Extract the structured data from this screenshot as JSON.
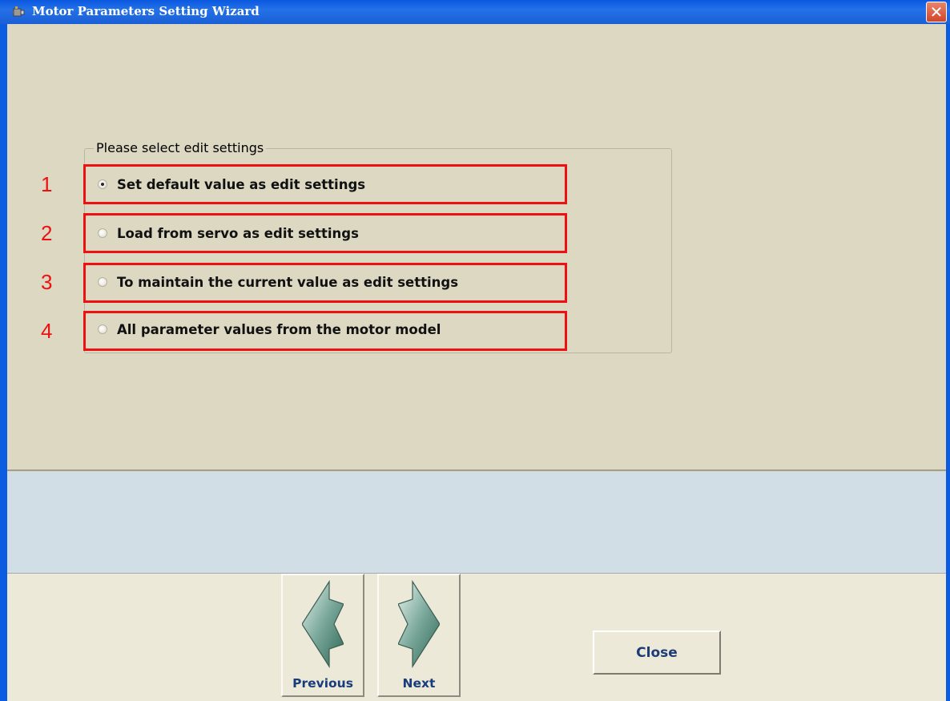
{
  "window": {
    "title": "Motor Parameters Setting Wizard",
    "icon": "motor-app-icon",
    "close_glyph": "✕"
  },
  "group": {
    "title": "Please select edit settings",
    "options": [
      {
        "number": "1",
        "label": "Set default value as edit settings",
        "checked": true
      },
      {
        "number": "2",
        "label": "Load from servo as edit settings",
        "checked": false
      },
      {
        "number": "3",
        "label": "To maintain the current value as edit settings",
        "checked": false
      },
      {
        "number": "4",
        "label": "All parameter values from the motor model",
        "checked": false
      }
    ]
  },
  "buttons": {
    "previous": "Previous",
    "next": "Next",
    "close": "Close"
  },
  "colors": {
    "annotation_red": "#ee1111",
    "title_bar_blue": "#0b5ce0",
    "panel_beige": "#dcd8c2",
    "info_panel": "#d2dee6"
  }
}
